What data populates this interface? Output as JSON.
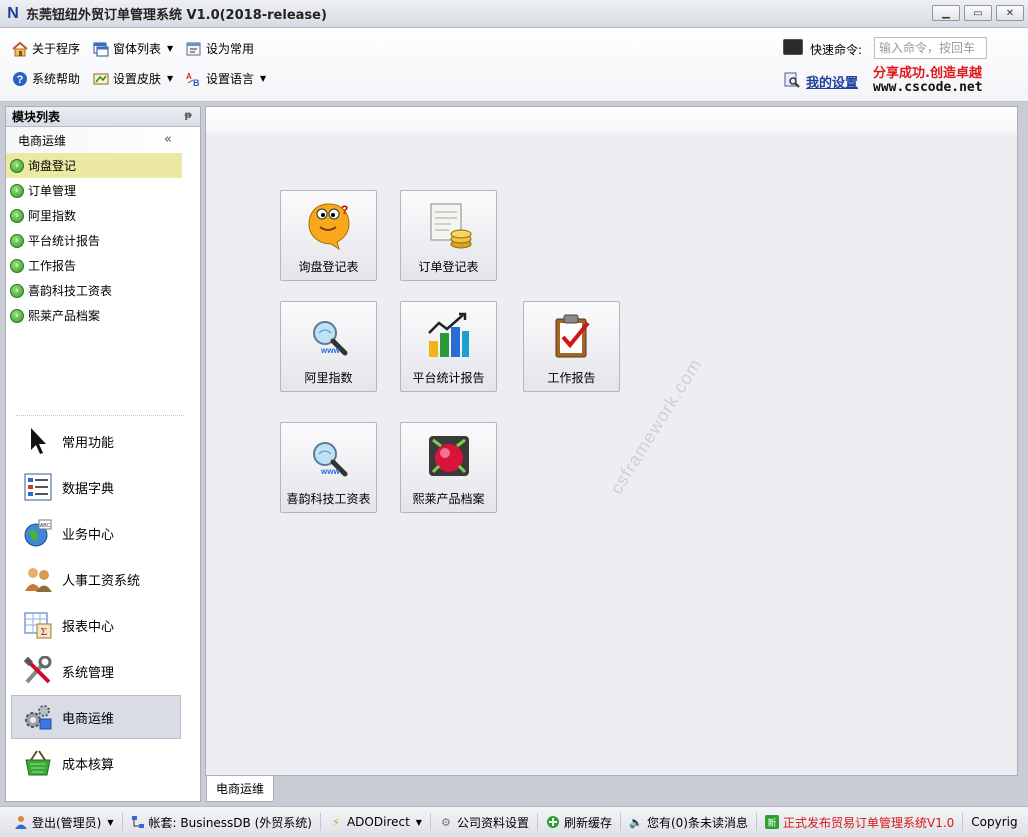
{
  "window": {
    "title": "东莞钮纽外贸订单管理系统 V1.0(2018-release)",
    "logo_letter": "N",
    "controls": [
      "minimize",
      "maximize",
      "close"
    ]
  },
  "toolbar": {
    "about": "关于程序",
    "window_list": "窗体列表",
    "set_common": "设为常用",
    "help": "系统帮助",
    "skin": "设置皮肤",
    "language": "设置语言",
    "quick_command_label": "快速命令:",
    "quick_command_placeholder": "输入命令，按回车",
    "my_settings": "我的设置",
    "slogan_line1": "分享成功.创造卓越",
    "slogan_line2": "www.cscode.net"
  },
  "left_panel": {
    "header": "模块列表",
    "group_title": "电商运维",
    "modules": [
      {
        "label": "询盘登记",
        "active": true
      },
      {
        "label": "订单管理",
        "active": false
      },
      {
        "label": "阿里指数",
        "active": false
      },
      {
        "label": "平台统计报告",
        "active": false
      },
      {
        "label": "工作报告",
        "active": false
      },
      {
        "label": "喜韵科技工资表",
        "active": false
      },
      {
        "label": "熙莱产品档案",
        "active": false
      }
    ],
    "nav": [
      {
        "label": "常用功能",
        "icon": "cursor-icon"
      },
      {
        "label": "数据字典",
        "icon": "list-icon"
      },
      {
        "label": "业务中心",
        "icon": "globe-icon"
      },
      {
        "label": "人事工资系统",
        "icon": "people-icon"
      },
      {
        "label": "报表中心",
        "icon": "report-icon"
      },
      {
        "label": "系统管理",
        "icon": "tools-icon"
      },
      {
        "label": "电商运维",
        "icon": "gears-icon",
        "active": true
      },
      {
        "label": "成本核算",
        "icon": "basket-icon"
      }
    ]
  },
  "main": {
    "tiles": [
      {
        "label": "询盘登记表",
        "icon": "chat-smiley-icon"
      },
      {
        "label": "订单登记表",
        "icon": "ledger-coins-icon"
      },
      {
        "label": "阿里指数",
        "icon": "www-search-icon"
      },
      {
        "label": "平台统计报告",
        "icon": "bar-chart-icon"
      },
      {
        "label": "工作报告",
        "icon": "clipboard-check-icon"
      },
      {
        "label": "喜韵科技工资表",
        "icon": "www-search-icon"
      },
      {
        "label": "熙莱产品档案",
        "icon": "gem-icon"
      }
    ],
    "watermark": "csframework.com",
    "bottom_tab": "电商运维"
  },
  "statusbar": {
    "logout": "登出(管理员)",
    "account": "帐套: BusinessDB (外贸系统)",
    "connection": "ADODirect",
    "company_settings": "公司资料设置",
    "refresh_cache": "刷新缓存",
    "messages": "您有(0)条未读消息",
    "release": "正式发布贸易订单管理系统V1.0",
    "copyright": "Copyrig"
  },
  "colors": {
    "active_module_bg": "#ece9a5",
    "link_blue": "#1f3fa0",
    "slogan_red": "#e0181b",
    "status_red": "#d81616"
  }
}
